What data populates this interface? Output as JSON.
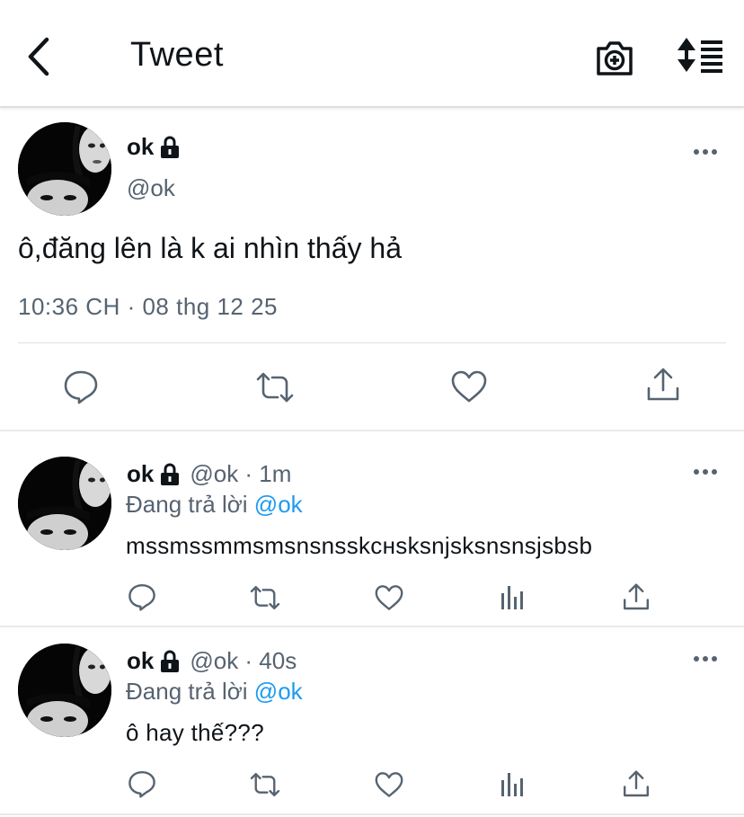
{
  "header": {
    "title": "Tweet",
    "back_icon": "chevron-left-icon",
    "camera_icon": "camera-plus-icon",
    "sort_icon": "sort-list-icon"
  },
  "main_tweet": {
    "name": "ok",
    "handle": "@ok",
    "text": "ô,đăng lên là k ai nhìn thấy hả",
    "timestamp": "10:36 CH · 08 thg 12 25"
  },
  "replies": [
    {
      "name": "ok",
      "meta": "@ok · 1m",
      "replying_prefix": "Đang trả lời",
      "replying_to": "@ok",
      "text": "mssmssmmsmsnsnsskснsksnjsksnsnsjsbsb"
    },
    {
      "name": "ok",
      "meta": "@ok · 40s",
      "replying_prefix": "Đang trả lời",
      "replying_to": "@ok",
      "text": "ô hay thế???"
    }
  ],
  "colors": {
    "text_primary": "#0f1419",
    "text_secondary": "#566370",
    "mention": "#1d9bf0",
    "divider": "#e8eaec"
  }
}
